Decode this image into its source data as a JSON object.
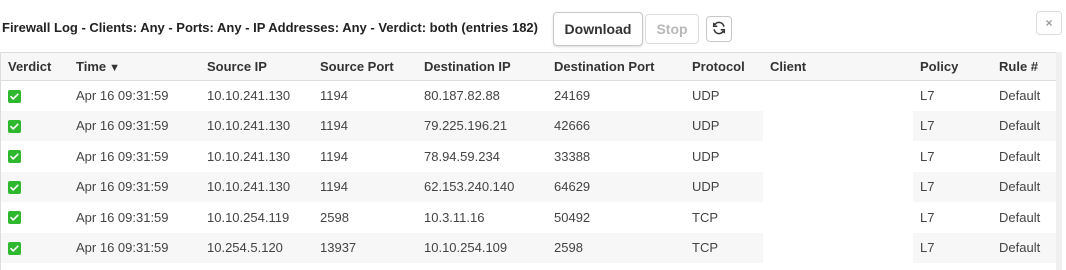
{
  "header": {
    "title": "Firewall Log - Clients: Any - Ports: Any - IP Addresses: Any - Verdict: both (entries 182)",
    "download_label": "Download",
    "stop_label": "Stop",
    "close_label": "×"
  },
  "table": {
    "columns": [
      "Verdict",
      "Time",
      "Source IP",
      "Source Port",
      "Destination IP",
      "Destination Port",
      "Protocol",
      "Client",
      "Policy",
      "Rule #"
    ],
    "sort_indicator": "▼",
    "rows": [
      {
        "verdict": "allowed",
        "time": "Apr 16 09:31:59",
        "source_ip": "10.10.241.130",
        "source_port": "1194",
        "destination_ip": "80.187.82.88",
        "destination_port": "24169",
        "protocol": "UDP",
        "client": "",
        "policy": "L7",
        "rule": "Default"
      },
      {
        "verdict": "allowed",
        "time": "Apr 16 09:31:59",
        "source_ip": "10.10.241.130",
        "source_port": "1194",
        "destination_ip": "79.225.196.21",
        "destination_port": "42666",
        "protocol": "UDP",
        "client": "",
        "policy": "L7",
        "rule": "Default"
      },
      {
        "verdict": "allowed",
        "time": "Apr 16 09:31:59",
        "source_ip": "10.10.241.130",
        "source_port": "1194",
        "destination_ip": "78.94.59.234",
        "destination_port": "33388",
        "protocol": "UDP",
        "client": "",
        "policy": "L7",
        "rule": "Default"
      },
      {
        "verdict": "allowed",
        "time": "Apr 16 09:31:59",
        "source_ip": "10.10.241.130",
        "source_port": "1194",
        "destination_ip": "62.153.240.140",
        "destination_port": "64629",
        "protocol": "UDP",
        "client": "",
        "policy": "L7",
        "rule": "Default"
      },
      {
        "verdict": "allowed",
        "time": "Apr 16 09:31:59",
        "source_ip": "10.10.254.119",
        "source_port": "2598",
        "destination_ip": "10.3.11.16",
        "destination_port": "50492",
        "protocol": "TCP",
        "client": "",
        "policy": "L7",
        "rule": "Default"
      },
      {
        "verdict": "allowed",
        "time": "Apr 16 09:31:59",
        "source_ip": "10.254.5.120",
        "source_port": "13937",
        "destination_ip": "10.10.254.109",
        "destination_port": "2598",
        "protocol": "TCP",
        "client": "",
        "policy": "L7",
        "rule": "Default"
      }
    ]
  },
  "colors": {
    "allowed": "#2eb82e",
    "header_bg": "#f7f7f7",
    "border": "#dddddd"
  },
  "icons": {
    "verdict": "check-icon",
    "refresh": "refresh-icon",
    "close": "close-icon"
  }
}
